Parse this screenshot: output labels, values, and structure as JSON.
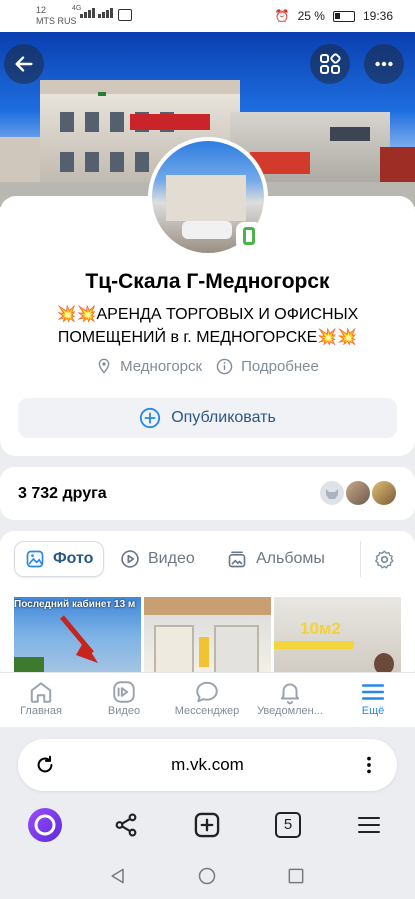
{
  "status_bar": {
    "carrier_top": "12",
    "carrier_name": "MTS RUS",
    "network": "4G",
    "battery": "25 %",
    "time": "19:36"
  },
  "cover": {
    "back_icon": "back-arrow-icon",
    "apps_icon": "apps-grid-icon",
    "more_icon": "more-dots-icon"
  },
  "profile": {
    "name": "Тц-Скала Г-Медногорск",
    "status_line1": "💥💥АРЕНДА ТОРГОВЫХ И ОФИСНЫХ",
    "status_line2": "ПОМЕЩЕНИЙ в г. МЕДНОГОРСКЕ💥💥",
    "city": "Медногорск",
    "details": "Подробнее",
    "publish": "Опубликовать"
  },
  "friends": {
    "count_label": "3 732 друга"
  },
  "media": {
    "tabs": [
      "Фото",
      "Видео",
      "Альбомы"
    ],
    "photo1_caption": "Последний кабинет 13 м",
    "photo3_caption": "10м2"
  },
  "app_nav": {
    "items": [
      "Главная",
      "Видео",
      "Мессенджер",
      "Уведомлен...",
      "Ещё"
    ]
  },
  "browser": {
    "url": "m.vk.com",
    "tab_count": "5"
  },
  "colors": {
    "accent": "#2688eb",
    "link": "#2a5885",
    "secondary_text": "#818c99",
    "online": "#4bb34b"
  }
}
